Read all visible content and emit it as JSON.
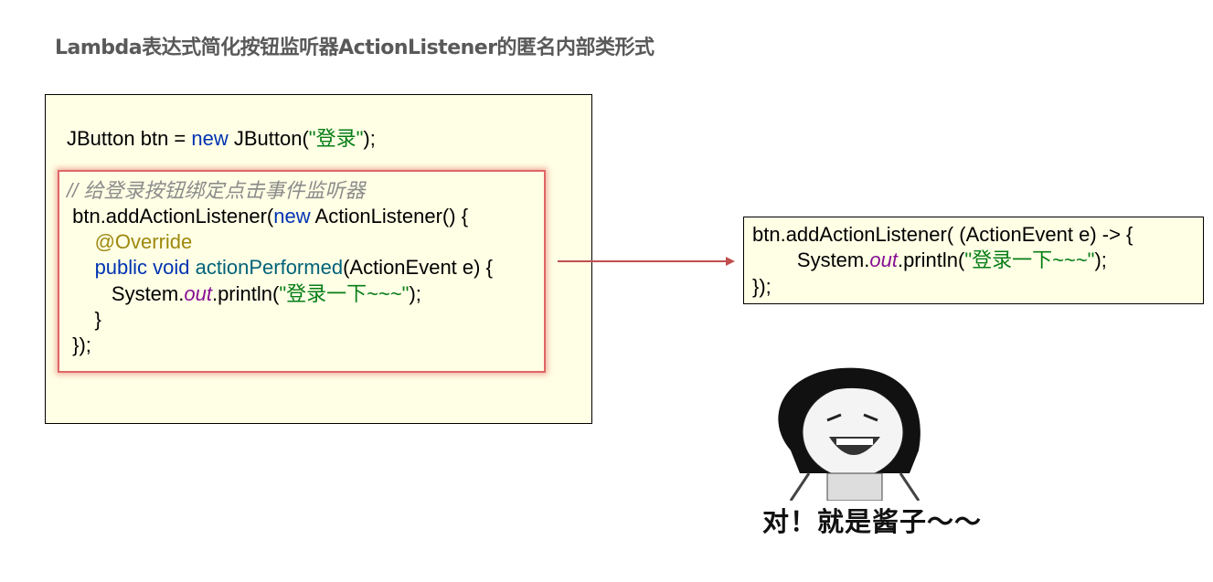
{
  "title": "Lambda表达式简化按钮监听器ActionListener的匿名内部类形式",
  "left_code": [
    [
      [
        "JButton btn = ",
        ""
      ],
      [
        "new",
        "kw"
      ],
      [
        " JButton(",
        ""
      ],
      [
        "\"登录\"",
        "str"
      ],
      [
        ");",
        ""
      ]
    ],
    [],
    [
      [
        "// 给登录按钮绑定点击事件监听器",
        "cmt"
      ]
    ],
    [
      [
        " btn.addActionListener(",
        ""
      ],
      [
        "new",
        "kw"
      ],
      [
        " ActionListener() {",
        ""
      ]
    ],
    [
      [
        "     ",
        ""
      ],
      [
        "@Override",
        "ann"
      ]
    ],
    [
      [
        "     ",
        ""
      ],
      [
        "public void ",
        "kw"
      ],
      [
        "actionPerformed",
        "fn"
      ],
      [
        "(ActionEvent e) {",
        ""
      ]
    ],
    [
      [
        "        System.",
        ""
      ],
      [
        "out",
        "fld"
      ],
      [
        ".println(",
        ""
      ],
      [
        "\"登录一下~~~\"",
        "str"
      ],
      [
        ");",
        ""
      ]
    ],
    [
      [
        "     }",
        ""
      ]
    ],
    [
      [
        " });",
        ""
      ]
    ]
  ],
  "right_code": [
    [
      [
        "btn.addActionListener( (ActionEvent e) -> {",
        ""
      ]
    ],
    [
      [
        "        System.",
        ""
      ],
      [
        "out",
        "fld"
      ],
      [
        ".println(",
        ""
      ],
      [
        "\"登录一下~~~\"",
        "str"
      ],
      [
        ");",
        ""
      ]
    ],
    [
      [
        "});",
        ""
      ]
    ]
  ],
  "meme": {
    "caption": "对！就是酱子～～"
  }
}
